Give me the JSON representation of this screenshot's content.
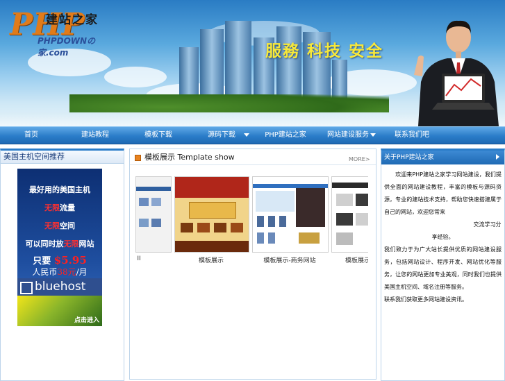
{
  "header": {
    "logo_big": "PHP",
    "logo_cn": "建站之家",
    "logo_domain": "PHPDOWNの家.com",
    "slogan": "服務 科技 安全"
  },
  "nav": {
    "items": [
      {
        "label": "首页",
        "has_dropdown": false
      },
      {
        "label": "建站教程",
        "has_dropdown": false
      },
      {
        "label": "模板下载",
        "has_dropdown": false
      },
      {
        "label": "源码下载",
        "has_dropdown": true
      },
      {
        "label": "PHP建站之家",
        "has_dropdown": false
      },
      {
        "label": "网站建设服务",
        "has_dropdown": true
      },
      {
        "label": "联系我们吧",
        "has_dropdown": false
      }
    ]
  },
  "left_panel": {
    "title": "美国主机空间推荐",
    "ad": {
      "line1": "最好用的美国主机",
      "line2_red": "无限",
      "line2_rest": "流量",
      "line3_red": "无限",
      "line3_rest": "空间",
      "line4_pre": "可以同时放",
      "line4_red": "无限",
      "line4_post": "网站",
      "line5_pre": "只要",
      "line5_price": "$5.95",
      "line6_pre": "人民币",
      "line6_price": "38元",
      "line6_post": "/月",
      "brand": "bluehost",
      "enter": "点击进入"
    }
  },
  "mid_panel": {
    "title": "模板展示 Template show",
    "more": "MORE>",
    "thumbs": [
      {
        "caption": "II"
      },
      {
        "caption": "模板展示"
      },
      {
        "caption": "模板展示-商务网站"
      },
      {
        "caption": "模板展示"
      }
    ]
  },
  "right_panel": {
    "title": "关于PHP建站之家",
    "paragraphs": [
      "　　欢迎来PHP建站之家学习网站建设，我们提供全面的网站建设教程，丰富的模板与源码资源，专业的建站技术支持，帮助您快速搭建属于自己的网站，欢迎您常来",
      "　　　　　　　　　　　　　　　　交流学习分享经验。",
      "我们致力于为广大站长提供优质的网站建设服务，包括网站设计、程序开发、网站优化等服务，让您的网站更加专业美观，同时我们也提供美国主机空间、域名注册等服务。",
      "联系我们获取更多网站建设资讯。"
    ]
  },
  "colors": {
    "nav_blue": "#2a7cc8",
    "slogan_yellow": "#f7e83a",
    "ad_red": "#ff3030",
    "accent_orange": "#e8821e"
  }
}
